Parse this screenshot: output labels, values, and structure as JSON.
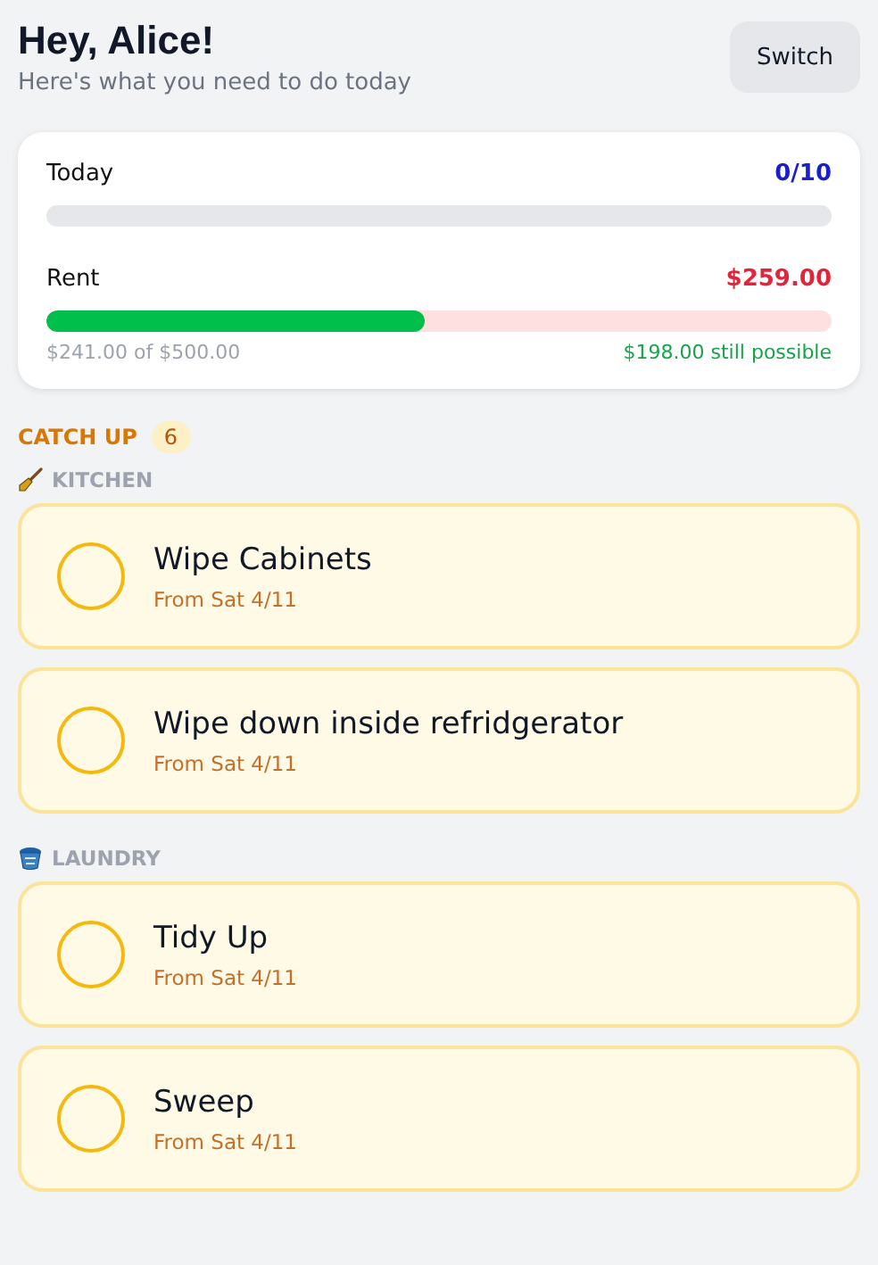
{
  "header": {
    "title": "Hey, Alice!",
    "subtitle": "Here's what you need to do today",
    "button": "Switch"
  },
  "summary": {
    "today": {
      "label": "Today",
      "value": "0/10",
      "level": 0
    },
    "rent": {
      "label": "Rent",
      "value": "$259.00",
      "level": 0.482,
      "paid": "$241.00 of $500.00",
      "possible": "$198.00 still possible"
    }
  },
  "section": {
    "title": "CATCH UP",
    "count": "6"
  },
  "categories": [
    {
      "name": "KITCHEN",
      "tasks": [
        {
          "title": "Wipe Cabinets",
          "date": "From Sat 4/11",
          "checked": false
        },
        {
          "title": "Wipe down inside refridgerator",
          "date": "From Sat 4/11",
          "checked": false
        }
      ]
    },
    {
      "name": "LAUNDRY",
      "tasks": [
        {
          "title": "Tidy Up",
          "date": "From Sat 4/11",
          "checked": false
        },
        {
          "title": "Sweep",
          "date": "From Sat 4/11",
          "checked": false
        }
      ]
    }
  ]
}
